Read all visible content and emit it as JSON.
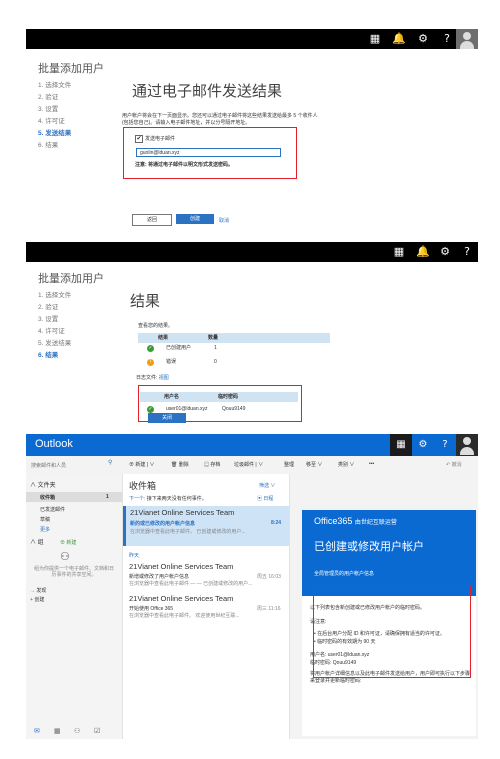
{
  "colors": {
    "accent": "#2b72c2",
    "red_box": "#e1202a",
    "outlook_blue": "#0a6ad2",
    "success": "#3a9a3a",
    "warning": "#f39c12",
    "mail_banner": "#0a6ad2"
  },
  "topbar_icons": [
    "grid-icon",
    "notification-icon",
    "gear-icon",
    "help-icon",
    "avatar"
  ],
  "topbar_glyphs": {
    "grid": "▦",
    "bell": "🔔",
    "gear": "⚙",
    "help": "?"
  },
  "panel1": {
    "page_title": "批量添加用户",
    "steps": [
      "1.  选择文件",
      "2.  验证",
      "3.  设置",
      "4.  许可证",
      "5.  发送结果",
      "6.  结果"
    ],
    "heading": "通过电子邮件发送结果",
    "instruction": "用户帐户将会在下一页面显示。您还可以通过电子邮件将这些结果发送给最多 5 个收件人(包括您自己)。请输入电子邮件地址，并以分号隔开地址。",
    "checkbox_label": "发送电子邮件",
    "email_value": "guolin@lduan.xyz",
    "note": "注意: 将通过电子邮件以明文形式发送密码。",
    "back": "返回",
    "create": "创建",
    "cancel": "取消"
  },
  "panel2": {
    "page_title": "批量添加用户",
    "steps": [
      "1.  选择文件",
      "2.  验证",
      "3.  设置",
      "4.  许可证",
      "5.  发送结果",
      "6.  结果"
    ],
    "heading": "结果",
    "view_results": "查看您的结果。",
    "table": {
      "headers": [
        "结果",
        "数量"
      ],
      "rows": [
        [
          "已创建用户",
          "1"
        ],
        [
          "错误",
          "0"
        ]
      ]
    },
    "log_label": "日志文件:",
    "log_link": "视图",
    "users_table": {
      "headers": [
        "用户名",
        "临时密码"
      ],
      "rows": [
        [
          "user01@lduan.xyz",
          "Qouu9149"
        ]
      ]
    },
    "close": "关闭"
  },
  "outlook": {
    "app_title": "Outlook",
    "search_placeholder": "搜索邮件和人员",
    "commands": [
      "⊕ 新建 | ∨",
      "🗑 删除",
      "▤ 存档",
      "垃圾邮件 | ∨",
      "整理",
      "移至 ∨",
      "类别 ∨",
      "•••"
    ],
    "undo": "↶ 撤消",
    "folders_header": "文件夹",
    "folders": [
      {
        "name": "收件箱",
        "count": "1"
      },
      {
        "name": "已发送邮件",
        "count": ""
      },
      {
        "name": "草稿",
        "count": ""
      },
      {
        "name": "更多",
        "count": ""
      }
    ],
    "groups_header": "组",
    "groups_new": "⊕ 新建",
    "groups_hint": "组为你提供一个电子邮件、文档和日历事件的共享空间。",
    "discover": "发现",
    "create": "创建",
    "inbox_title": "收件箱",
    "filter": "筛选 ∨",
    "next_prefix": "下一个:",
    "next_text": "接下来两天没有任何事件。",
    "agenda": "日程",
    "messages": [
      {
        "from": "21Vianet Online Services Team",
        "subject": "新的或已修改的用户帐户信息",
        "preview": "在浏览器中查看此电子邮件。 已创建或修改的用户...",
        "time": "8:24",
        "group": ""
      },
      {
        "from": "21Vianet Online Services Team",
        "subject": "新增或修改了用户帐户信息",
        "preview": "在浏览器中查看此电子邮件 — — 已创建或修改的用户...",
        "time": "周五 16:03",
        "group": "昨天"
      },
      {
        "from": "21Vianet Online Services Team",
        "subject": "开始使用 Office 365",
        "preview": "在浏览器中查看此电子邮件。 欢迎使用世纪互联...",
        "time": "周三 11:16",
        "group": ""
      }
    ],
    "mail": {
      "logo_brand": "Office365",
      "logo_suffix": "由世纪互联运营",
      "title": "已创建或修改用户帐户",
      "subtitle": "全局管理员的用户帐户信息",
      "intro": "以下列表包含新创建或已修改用户帐户的临时密码。",
      "note_label": "请注意:",
      "bullets": [
        "在后台用户分配 ID 和许可证，请确保拥有适当的许可证。",
        "临时密码的有效期为 90 天"
      ],
      "username_line": "用户名: user01@lduan.xyz",
      "password_line": "临时密码: Qouu9149",
      "footer": "将用户帐户详细信息以及此电子邮件发送给用户，用户即可执行以下步骤来登录并更新临时密码:"
    },
    "bottom_icons": [
      "mail-icon",
      "calendar-icon",
      "people-icon",
      "tasks-icon"
    ]
  }
}
